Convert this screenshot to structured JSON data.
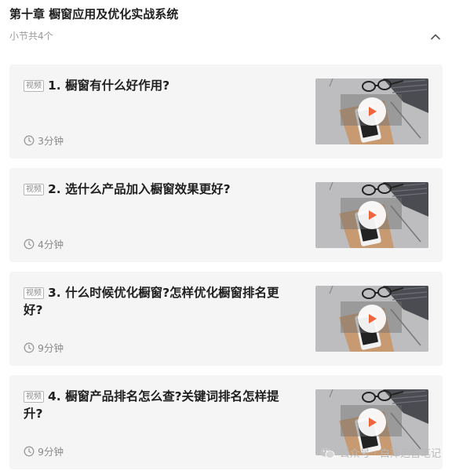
{
  "chapter": {
    "title": "第十章 橱窗应用及优化实战系统",
    "subtitle": "小节共4个"
  },
  "lessons": [
    {
      "tag": "视频",
      "title": "1. 橱窗有什么好作用?",
      "duration": "3分钟"
    },
    {
      "tag": "视频",
      "title": "2. 选什么产品加入橱窗效果更好?",
      "duration": "4分钟"
    },
    {
      "tag": "视频",
      "title": "3. 什么时候优化橱窗?怎样优化橱窗排名更好?",
      "duration": "9分钟"
    },
    {
      "tag": "视频",
      "title": "4. 橱窗产品排名怎么查?关键词排名怎样提升?",
      "duration": "9分钟"
    }
  ],
  "watermark": {
    "text": "公众号 · 白泽运营笔记"
  },
  "icons": {
    "collapse": "chevron-up-icon",
    "clock": "clock-icon",
    "play": "play-icon",
    "wechat": "wechat-icon"
  },
  "colors": {
    "play_accent": "#f0643c",
    "card_bg": "#f5f5f5"
  }
}
